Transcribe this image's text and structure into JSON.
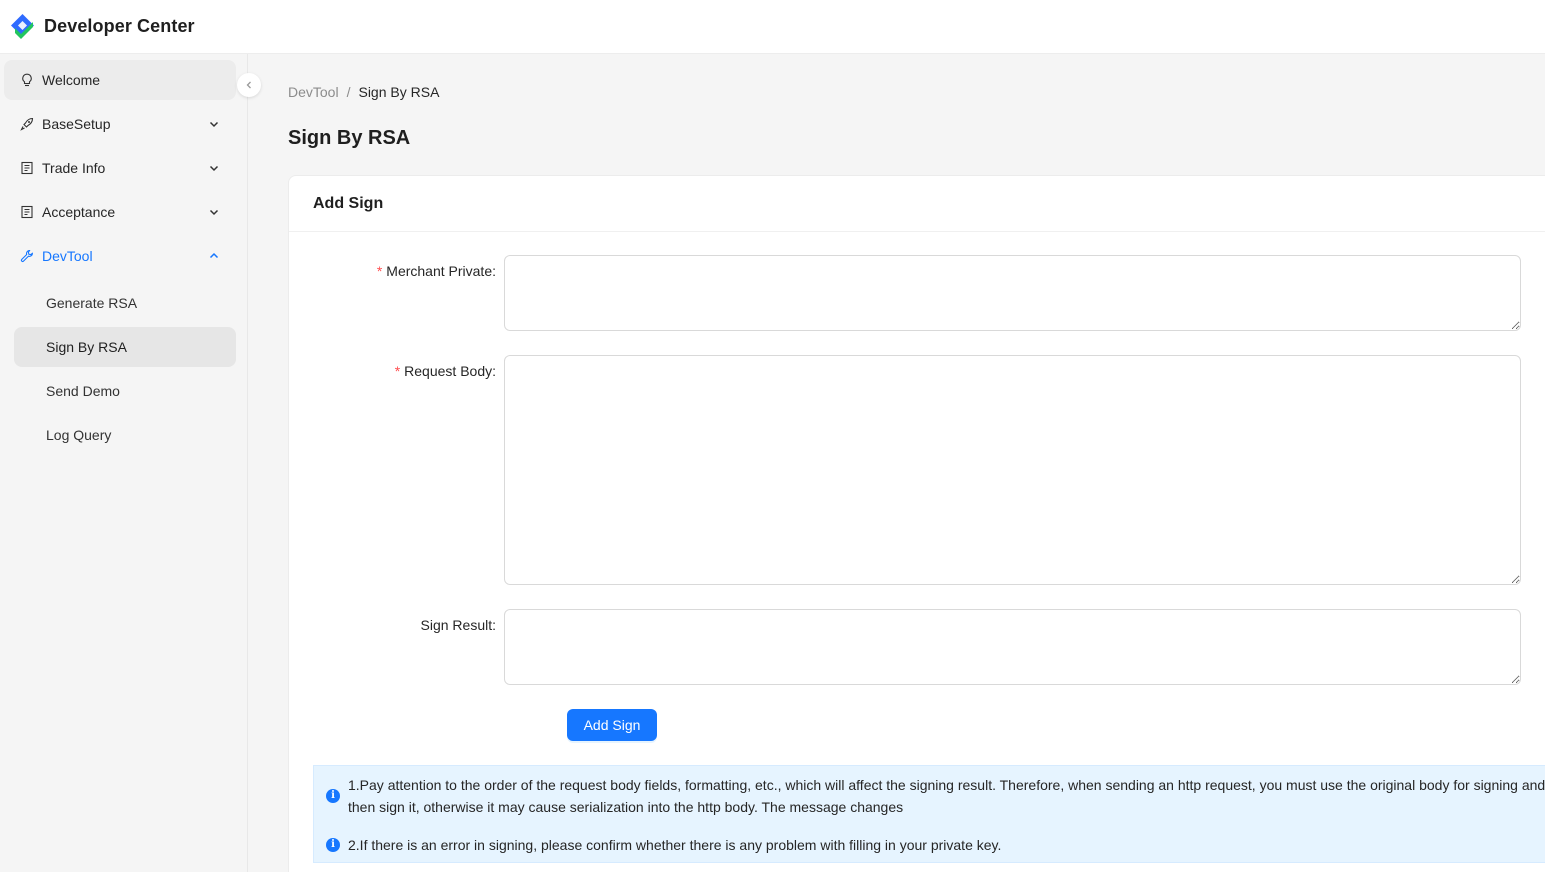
{
  "app": {
    "title": "Developer Center"
  },
  "sidebar": {
    "items": [
      {
        "label": "Welcome",
        "icon": "bulb-icon"
      },
      {
        "label": "BaseSetup",
        "icon": "rocket-icon"
      },
      {
        "label": "Trade Info",
        "icon": "receipt-icon"
      },
      {
        "label": "Acceptance",
        "icon": "receipt-icon"
      },
      {
        "label": "DevTool",
        "icon": "wrench-icon"
      }
    ],
    "devtool_children": [
      {
        "label": "Generate RSA"
      },
      {
        "label": "Sign By RSA"
      },
      {
        "label": "Send Demo"
      },
      {
        "label": "Log Query"
      }
    ]
  },
  "breadcrumb": {
    "parent": "DevTool",
    "separator": "/",
    "current": "Sign By RSA"
  },
  "page": {
    "title": "Sign By RSA"
  },
  "card": {
    "title": "Add Sign"
  },
  "form": {
    "merchant_private_label": "Merchant Private",
    "request_body_label": "Request Body",
    "sign_result_label": "Sign Result",
    "label_suffix": ":",
    "required_mark": "*",
    "merchant_private_value": "",
    "request_body_value": "",
    "sign_result_value": "",
    "submit_label": "Add Sign"
  },
  "tips": [
    "1.Pay attention to the order of the request body fields, formatting, etc., which will affect the signing result. Therefore, when sending an http request, you must use the original body for signing and then sign it, otherwise it may cause serialization into the http body. The message changes",
    "2.If there is an error in signing, please confirm whether there is any problem with filling in your private key."
  ],
  "colors": {
    "primary": "#1677ff",
    "required": "#ff4d4f",
    "alert_bg": "#e6f4ff"
  }
}
